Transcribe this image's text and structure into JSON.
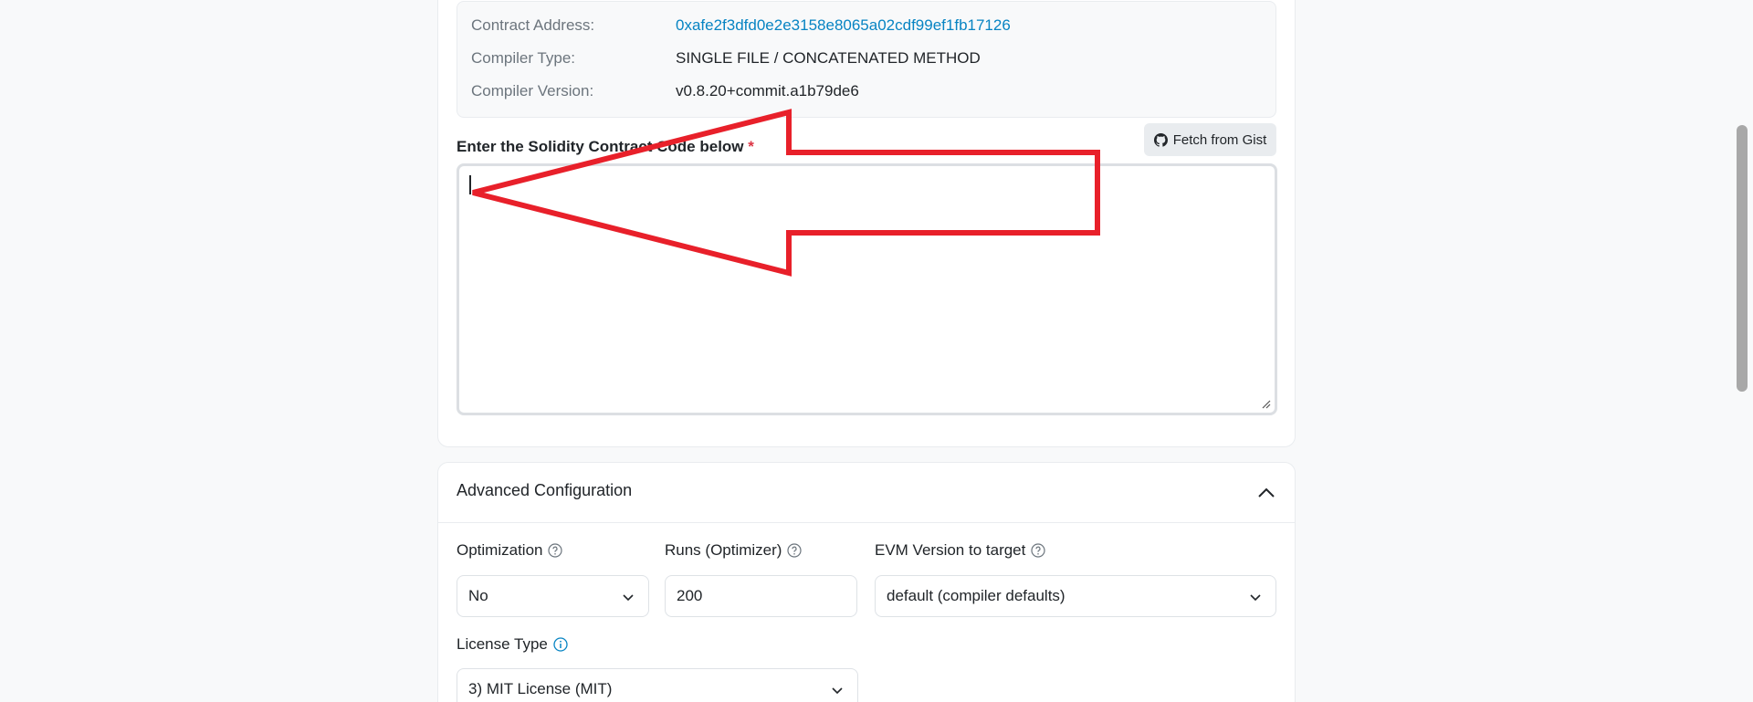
{
  "contract_info": {
    "address_label": "Contract Address:",
    "address_value": "0xafe2f3dfd0e2e3158e8065a02cdf99ef1fb17126",
    "compiler_type_label": "Compiler Type:",
    "compiler_type_value": "SINGLE FILE / CONCATENATED METHOD",
    "compiler_version_label": "Compiler Version:",
    "compiler_version_value": "v0.8.20+commit.a1b79de6"
  },
  "code_section": {
    "label": "Enter the Solidity Contract Code below",
    "required_mark": "*",
    "fetch_button_label": "Fetch from Gist",
    "code_value": ""
  },
  "advanced": {
    "title": "Advanced Configuration",
    "optimization_label": "Optimization",
    "optimization_value": "No",
    "runs_label": "Runs (Optimizer)",
    "runs_value": "200",
    "evm_label": "EVM Version to target",
    "evm_value": "default (compiler defaults)",
    "license_label": "License Type",
    "license_value": "3) MIT License (MIT)"
  },
  "colors": {
    "link": "#0784c3",
    "required": "#dc3545",
    "annotation": "#e8202a"
  },
  "icons": {
    "fetch": "github-icon",
    "help": "question-circle-icon",
    "info": "info-circle-icon",
    "collapse": "chevron-up-icon",
    "dropdown": "chevron-down-icon"
  }
}
